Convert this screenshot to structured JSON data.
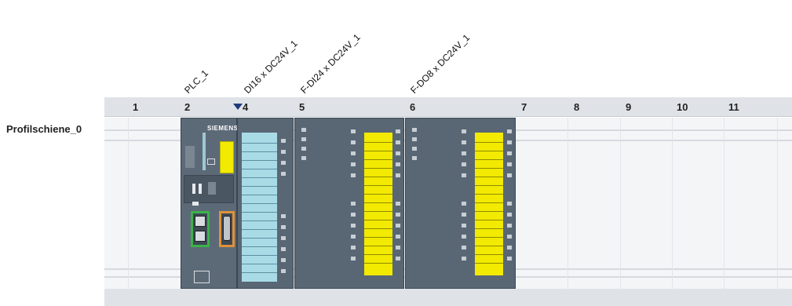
{
  "module_labels": [
    "PLC_1",
    "DI16 x DC24V_1",
    "F-DI24 x DC24V_1",
    "F-DO8 x DC24V_1"
  ],
  "slots": [
    "1",
    "2",
    "4",
    "5",
    "6",
    "7",
    "8",
    "9",
    "10",
    "11"
  ],
  "rail": {
    "name": "Profilschiene_0"
  },
  "cpu": {
    "brand": "SIEMENS"
  },
  "colors": {
    "module_body": "#596775",
    "io_strip_cyan": "#a9dbe7",
    "io_strip_yellow": "#f2ea00",
    "port_green": "#3bb24a",
    "port_orange": "#e0913a",
    "selection_arrow": "#1d3b7a"
  }
}
